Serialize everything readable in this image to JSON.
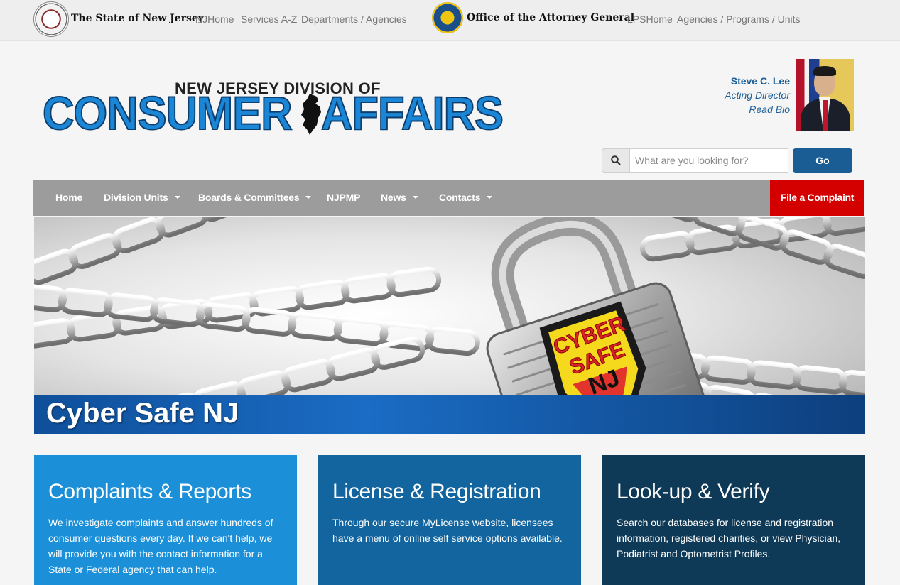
{
  "topbar": {
    "state_brand": "The State of New Jersey",
    "state_links": [
      "NJHome",
      "Services A-Z",
      "Departments / Agencies"
    ],
    "oag_brand": "Office of the Attorney General",
    "oag_links": [
      "LPSHome",
      "Agencies / Programs / Units"
    ]
  },
  "logo": {
    "line1": "NEW JERSEY DIVISION OF",
    "word1": "CONSUMER",
    "word2": "AFFAIRS"
  },
  "director": {
    "name": "Steve C. Lee",
    "title": "Acting Director",
    "bio_link": "Read Bio"
  },
  "search": {
    "placeholder": "What are you looking for?",
    "value": "",
    "go_label": "Go"
  },
  "nav": {
    "items": [
      {
        "label": "Home",
        "dropdown": false
      },
      {
        "label": "Division Units",
        "dropdown": true
      },
      {
        "label": "Boards & Committees",
        "dropdown": true
      },
      {
        "label": "NJPMP",
        "dropdown": false
      },
      {
        "label": "News",
        "dropdown": true
      },
      {
        "label": "Contacts",
        "dropdown": true
      }
    ],
    "complaint_label": "File a Complaint"
  },
  "hero": {
    "title": "Cyber Safe NJ",
    "badge": [
      "CYBER",
      "SAFE",
      "NJ"
    ]
  },
  "cards": [
    {
      "title": "Complaints & Reports",
      "text": "We investigate complaints and answer hundreds of consumer questions every day. If we can't help, we will provide you with the contact information for a State or Federal agency that can help."
    },
    {
      "title": "License & Registration",
      "text": "Through our secure MyLicense website, licensees have a menu of online self service options available."
    },
    {
      "title": "Look-up & Verify",
      "text": "Search our databases for license and registration information, registered charities, or view Physician, Podiatrist and Optometrist Profiles."
    }
  ],
  "colors": {
    "nav_bg": "#9c9c9c",
    "complaint_red": "#d40000",
    "go_blue": "#1a5d95",
    "card1": "#1b8fd8",
    "card2": "#13659f",
    "card3": "#0f3a57",
    "logo_blue": "#1b86d6"
  }
}
